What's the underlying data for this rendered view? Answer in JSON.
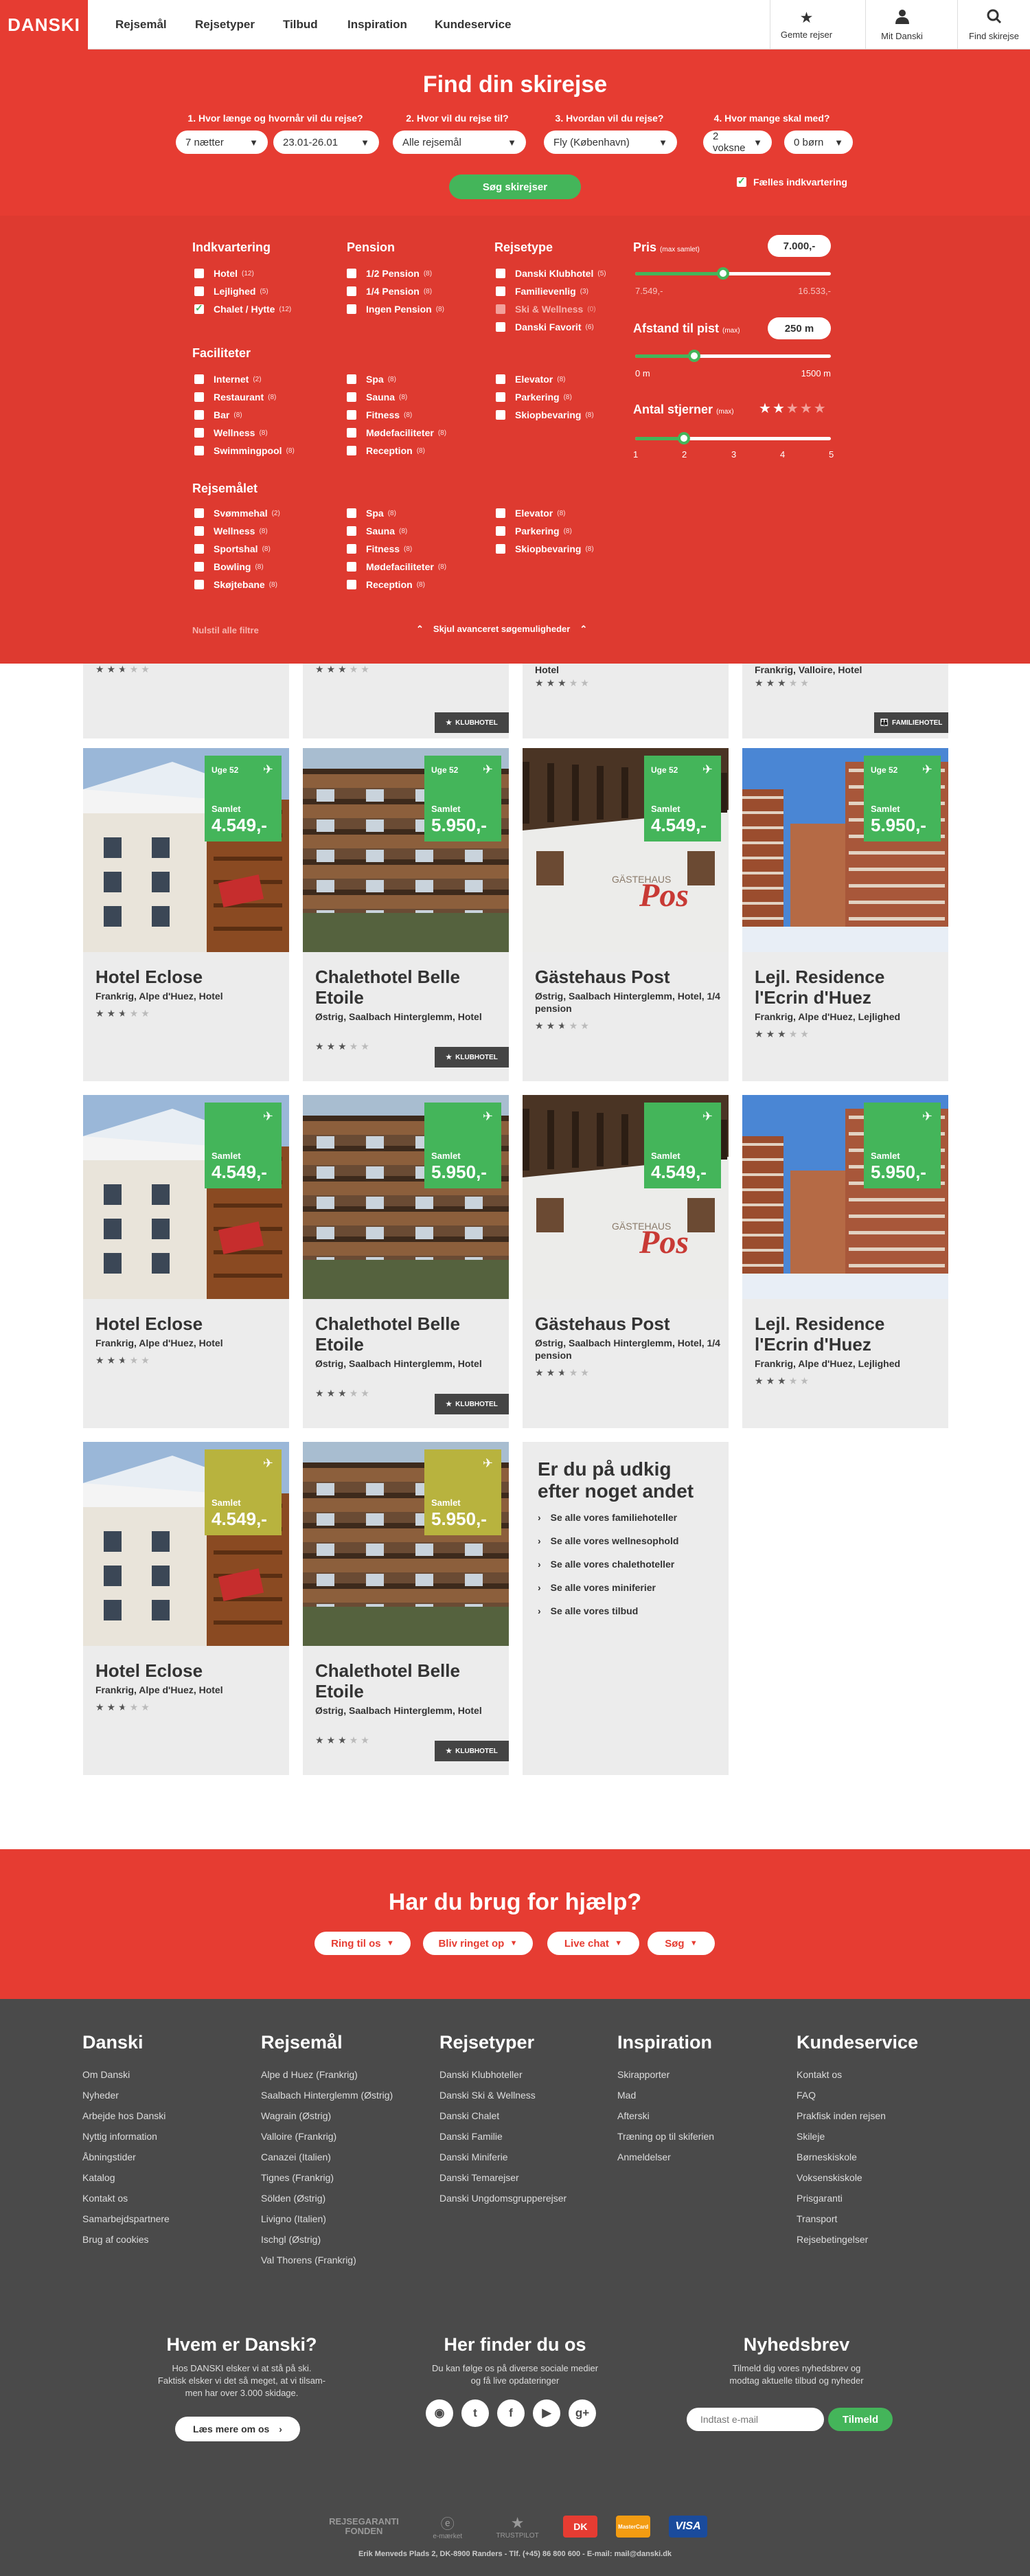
{
  "header": {
    "logo": "DANSKI",
    "nav": [
      "Rejsemål",
      "Rejsetyper",
      "Tilbud",
      "Inspiration",
      "Kundeservice"
    ],
    "actions": [
      "Gemte rejser",
      "Mit Danski",
      "Find skirejse"
    ]
  },
  "search": {
    "title": "Find din skirejse",
    "q1": "1. Hvor længe og hvornår vil du rejse?",
    "q2": "2. Hvor vil du rejse til?",
    "q3": "3. Hvordan vil du rejse?",
    "q4": "4. Hvor mange skal med?",
    "nights": "7 nætter",
    "dates": "23.01-26.01",
    "destination": "Alle rejsemål",
    "transport": "Fly (København)",
    "adults": "2 voksne",
    "children": "0 børn",
    "shared": "Fælles indkvartering",
    "submit": "Søg skirejser"
  },
  "filters": {
    "indkvartering": {
      "title": "Indkvartering",
      "items": [
        {
          "label": "Hotel",
          "count": "(12)"
        },
        {
          "label": "Lejlighed",
          "count": "(5)"
        },
        {
          "label": "Chalet / Hytte",
          "count": "(12)"
        }
      ]
    },
    "pension": {
      "title": "Pension",
      "items": [
        {
          "label": "1/2 Pension",
          "count": "(8)"
        },
        {
          "label": "1/4 Pension",
          "count": "(8)"
        },
        {
          "label": "Ingen Pension",
          "count": "(8)"
        }
      ]
    },
    "rejsetype": {
      "title": "Rejsetype",
      "items": [
        {
          "label": "Danski Klubhotel",
          "count": "(5)"
        },
        {
          "label": "Familievenlig",
          "count": "(3)"
        },
        {
          "label": "Ski & Wellness",
          "count": "(0)"
        },
        {
          "label": "Danski Favorit",
          "count": "(6)"
        }
      ]
    },
    "faciliteter": {
      "title": "Faciliteter",
      "col1": [
        {
          "label": "Internet",
          "count": "(2)"
        },
        {
          "label": "Restaurant",
          "count": "(8)"
        },
        {
          "label": "Bar",
          "count": "(8)"
        },
        {
          "label": "Wellness",
          "count": "(8)"
        },
        {
          "label": "Swimmingpool",
          "count": "(8)"
        }
      ],
      "col2": [
        {
          "label": "Spa",
          "count": "(8)"
        },
        {
          "label": "Sauna",
          "count": "(8)"
        },
        {
          "label": "Fitness",
          "count": "(8)"
        },
        {
          "label": "Mødefaciliteter",
          "count": "(8)"
        },
        {
          "label": "Reception",
          "count": "(8)"
        }
      ],
      "col3": [
        {
          "label": "Elevator",
          "count": "(8)"
        },
        {
          "label": "Parkering",
          "count": "(8)"
        },
        {
          "label": "Skiopbevaring",
          "count": "(8)"
        }
      ]
    },
    "rejsemaal": {
      "title": "Rejsemålet",
      "col1": [
        {
          "label": "Svømmehal",
          "count": "(2)"
        },
        {
          "label": "Wellness",
          "count": "(8)"
        },
        {
          "label": "Sportshal",
          "count": "(8)"
        },
        {
          "label": "Bowling",
          "count": "(8)"
        },
        {
          "label": "Skøjtebane",
          "count": "(8)"
        }
      ],
      "col2": [
        {
          "label": "Spa",
          "count": "(8)"
        },
        {
          "label": "Sauna",
          "count": "(8)"
        },
        {
          "label": "Fitness",
          "count": "(8)"
        },
        {
          "label": "Mødefaciliteter",
          "count": "(8)"
        },
        {
          "label": "Reception",
          "count": "(8)"
        }
      ],
      "col3": [
        {
          "label": "Elevator",
          "count": "(8)"
        },
        {
          "label": "Parkering",
          "count": "(8)"
        },
        {
          "label": "Skiopbevaring",
          "count": "(8)"
        }
      ]
    },
    "price": {
      "title": "Pris",
      "sub": "(max samlet)",
      "value": "7.000,-",
      "min": "7.549,-",
      "max": "16.533,-",
      "level": 0.45
    },
    "distance": {
      "title": "Afstand til pist",
      "sub": "(max)",
      "value": "250 m",
      "min": "0 m",
      "max": "1500 m",
      "level": 0.3
    },
    "stars": {
      "title": "Antal stjerner",
      "sub": "(max)",
      "ticks": [
        "1",
        "2",
        "3",
        "4",
        "5"
      ],
      "selected": 2
    },
    "reset": "Nulstil alle filtre",
    "hide": "Skjul avanceret søgemuligheder"
  },
  "partial_cards": [
    {
      "loc": "",
      "stars": 2.5,
      "badge": ""
    },
    {
      "loc": "",
      "stars": 3,
      "badge": "KLUBHOTEL"
    },
    {
      "loc": "Hotel",
      "stars": 3,
      "badge": ""
    },
    {
      "loc": "Frankrig, Valloire, Hotel",
      "stars": 3,
      "badge": "FAMILIEHOTEL"
    }
  ],
  "cards": [
    {
      "name": "Hotel Eclose",
      "loc": "Frankrig, Alpe d'Huez, Hotel",
      "week": "Uge 52",
      "samlet": "Samlet",
      "price": "4.549,-",
      "stars": 2.5,
      "badge": "",
      "img": "eclose",
      "tag": "green"
    },
    {
      "name": "Chalethotel Belle Etoile",
      "loc": "Østrig, Saalbach Hinterglemm, Hotel",
      "week": "Uge 52",
      "samlet": "Samlet",
      "price": "5.950,-",
      "stars": 3,
      "badge": "KLUBHOTEL",
      "img": "chalet",
      "tag": "green"
    },
    {
      "name": "Gästehaus Post",
      "loc": "Østrig, Saalbach Hinterglemm, Hotel, 1/4 pension",
      "week": "Uge 52",
      "samlet": "Samlet",
      "price": "4.549,-",
      "stars": 2.5,
      "badge": "",
      "img": "post",
      "tag": "green"
    },
    {
      "name": "Lejl. Residence l'Ecrin d'Huez",
      "loc": "Frankrig, Alpe d'Huez, Lejlighed",
      "week": "Uge 52",
      "samlet": "Samlet",
      "price": "5.950,-",
      "stars": 3,
      "badge": "",
      "img": "tower",
      "tag": "green"
    },
    {
      "name": "Hotel Eclose",
      "loc": "Frankrig, Alpe d'Huez, Hotel",
      "week": "",
      "samlet": "Samlet",
      "price": "4.549,-",
      "stars": 2.5,
      "badge": "",
      "img": "eclose",
      "tag": "green"
    },
    {
      "name": "Chalethotel Belle Etoile",
      "loc": "Østrig, Saalbach Hinterglemm, Hotel",
      "week": "",
      "samlet": "Samlet",
      "price": "5.950,-",
      "stars": 3,
      "badge": "KLUBHOTEL",
      "img": "chalet",
      "tag": "green"
    },
    {
      "name": "Gästehaus Post",
      "loc": "Østrig, Saalbach Hinterglemm, Hotel, 1/4 pension",
      "week": "",
      "samlet": "Samlet",
      "price": "4.549,-",
      "stars": 2.5,
      "badge": "",
      "img": "post",
      "tag": "green"
    },
    {
      "name": "Lejl. Residence l'Ecrin d'Huez",
      "loc": "Frankrig, Alpe d'Huez, Lejlighed",
      "week": "",
      "samlet": "Samlet",
      "price": "5.950,-",
      "stars": 3,
      "badge": "",
      "img": "tower",
      "tag": "green"
    },
    {
      "name": "Hotel Eclose",
      "loc": "Frankrig, Alpe d'Huez, Hotel",
      "week": "",
      "samlet": "Samlet",
      "price": "4.549,-",
      "stars": 2.5,
      "badge": "",
      "img": "eclose",
      "tag": "olive"
    },
    {
      "name": "Chalethotel Belle Etoile",
      "loc": "Østrig, Saalbach Hinterglemm, Hotel",
      "week": "",
      "samlet": "Samlet",
      "price": "5.950,-",
      "stars": 3,
      "badge": "KLUBHOTEL",
      "img": "chalet",
      "tag": "olive"
    }
  ],
  "other": {
    "title": "Er du på udkig efter noget andet",
    "links": [
      "Se alle vores familiehoteller",
      "Se alle vores wellnesophold",
      "Se alle vores chalethoteller",
      "Se alle vores miniferier",
      "Se alle vores tilbud"
    ]
  },
  "help": {
    "title": "Har du brug for hjælp?",
    "buttons": [
      "Ring til os",
      "Bliv ringet op",
      "Live chat",
      "Søg"
    ]
  },
  "footer": {
    "cols": [
      {
        "title": "Danski",
        "items": [
          "Om Danski",
          "Nyheder",
          "Arbejde hos Danski",
          "Nyttig information",
          "Åbningstider",
          "Katalog",
          "Kontakt os",
          "Samarbejdspartnere",
          "Brug af cookies"
        ]
      },
      {
        "title": "Rejsemål",
        "items": [
          "Alpe d Huez (Frankrig)",
          "Saalbach Hinterglemm (Østrig)",
          "Wagrain (Østrig)",
          "Valloire (Frankrig)",
          "Canazei (Italien)",
          "Tignes (Frankrig)",
          "Sölden (Østrig)",
          "Livigno (Italien)",
          "Ischgl (Østrig)",
          "Val Thorens (Frankrig)"
        ]
      },
      {
        "title": "Rejsetyper",
        "items": [
          "Danski Klubhoteller",
          "Danski Ski & Wellness",
          "Danski Chalet",
          "Danski Familie",
          "Danski Miniferie",
          "Danski Temarejser",
          "Danski Ungdomsgrupperejser"
        ]
      },
      {
        "title": "Inspiration",
        "items": [
          "Skirapporter",
          "Mad",
          "Afterski",
          "Træning op til skiferien",
          "Anmeldelser"
        ]
      },
      {
        "title": "Kundeservice",
        "items": [
          "Kontakt os",
          "FAQ",
          "Prakfisk inden rejsen",
          "Skileje",
          "Børneskiskole",
          "Voksenskiskole",
          "Prisgaranti",
          "Transport",
          "Rejsebetingelser"
        ]
      }
    ],
    "about": {
      "title": "Hvem er Danski?",
      "text1": "Hos DANSKI elsker vi at stå på ski.",
      "text2": "Faktisk elsker vi det så meget, at vi tilsam-",
      "text3": "men har over 3.000 skidage.",
      "button": "Læs mere om os"
    },
    "social": {
      "title": "Her finder du os",
      "text1": "Du kan følge os på diverse sociale medier",
      "text2": "og få live opdateringer",
      "icons": [
        "rss-icon",
        "twitter-icon",
        "facebook-icon",
        "youtube-icon",
        "googleplus-icon"
      ]
    },
    "newsletter": {
      "title": "Nyhedsbrev",
      "text1": "Tilmeld dig vores nyhedsbrev og",
      "text2": "modtag aktuelle tilbud og nyheder",
      "placeholder": "Indtast e-mail",
      "button": "Tilmeld"
    },
    "logos": [
      "REJSEGARANTI FONDEN",
      "e-mærket",
      "TRUSTPILOT",
      "DK",
      "MasterCard",
      "VISA"
    ],
    "address": "Erik Menveds Plads 2, DK-8900 Randers - Tlf. (+45) 86 800 600 - E-mail: mail@danski.dk"
  },
  "colors": {
    "brand_red": "#e63c32",
    "green": "#44b55a",
    "olive": "#b8b33e",
    "footer": "#4a4a4a"
  }
}
